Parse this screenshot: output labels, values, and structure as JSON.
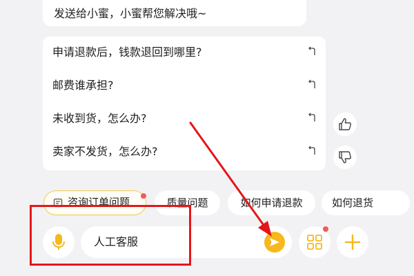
{
  "chat": {
    "previous_message_tail": "发送给小蜜，小蜜帮您解决哦~"
  },
  "faq": {
    "items": [
      {
        "question": "申请退款后，钱款退回到哪里?"
      },
      {
        "question": "邮费谁承担?"
      },
      {
        "question": "未收到货，怎么办?"
      },
      {
        "question": "卖家不发货，怎么办?"
      }
    ],
    "arrow_icon": "return-arrow-icon"
  },
  "feedback": {
    "like_icon": "thumbs-up-icon",
    "dislike_icon": "thumbs-down-icon"
  },
  "quick_topics": {
    "chips": [
      {
        "label": "咨询订单问题",
        "icon": "order-icon",
        "has_badge": true
      },
      {
        "label": "质量问题"
      },
      {
        "label": "如何申请退款"
      },
      {
        "label": "如何退货"
      }
    ]
  },
  "input_bar": {
    "mic_icon": "microphone-icon",
    "input_value": "人工客服",
    "send_icon": "send-icon",
    "apps_icon": "grid-icon",
    "add_icon": "plus-icon"
  },
  "colors": {
    "accent": "#f6b81b",
    "badge": "#f45a5a",
    "annotation": "#e4161a",
    "background": "#f2f2f4"
  }
}
